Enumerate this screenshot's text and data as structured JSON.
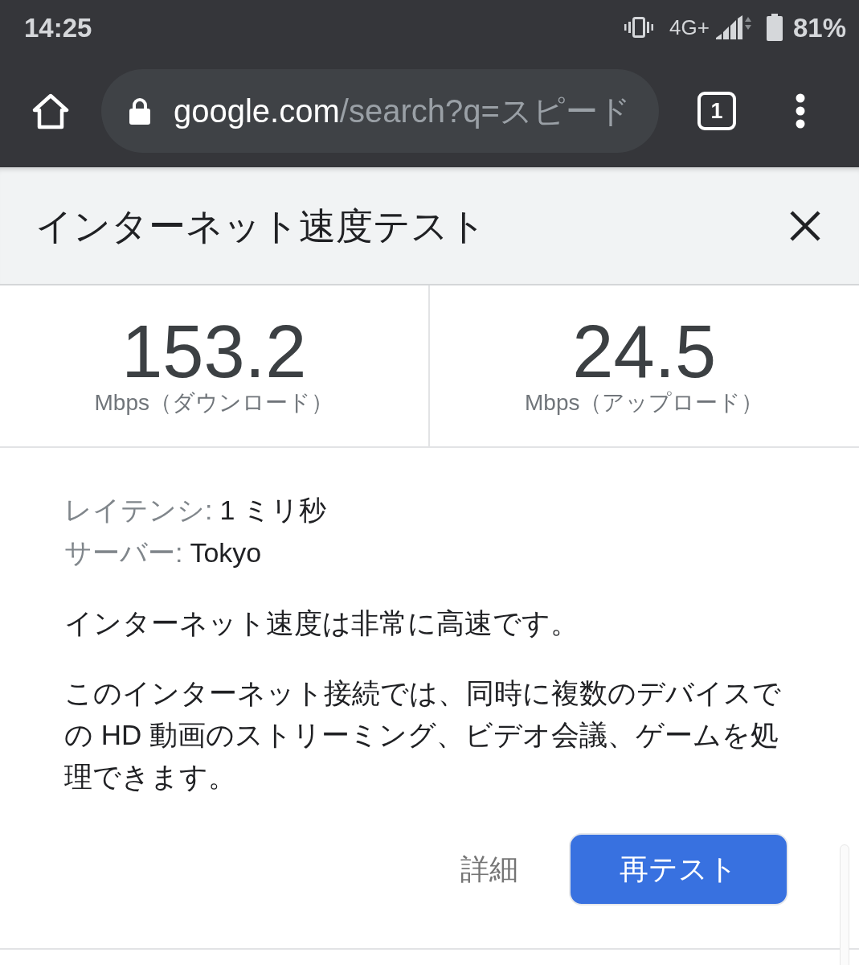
{
  "status_bar": {
    "time": "14:25",
    "network": "4G+",
    "battery": "81%"
  },
  "browser_toolbar": {
    "url_host": "google.com",
    "url_path": "/search?q=スピード",
    "tab_count": "1"
  },
  "dialog": {
    "title": "インターネット速度テスト",
    "results": [
      {
        "value": "153.2",
        "unit": "Mbps（ダウンロード）"
      },
      {
        "value": "24.5",
        "unit": "Mbps（アップロード）"
      }
    ],
    "details": [
      {
        "label": "レイテンシ:",
        "value": "1 ミリ秒"
      },
      {
        "label": "サーバー:",
        "value": "Tokyo"
      }
    ],
    "summary": "インターネット速度は非常に高速です。",
    "description": "このインターネット接続では、同時に複数のデバイスでの HD 動画のストリーミング、ビデオ会議、ゲームを処理できます。",
    "buttons": [
      {
        "label": "詳細",
        "kind": "text"
      },
      {
        "label": "再テスト",
        "kind": "filled"
      }
    ]
  }
}
